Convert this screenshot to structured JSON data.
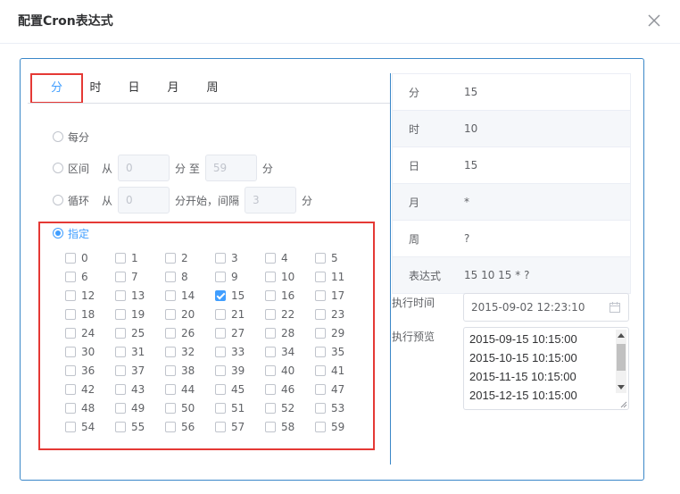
{
  "dialog": {
    "title": "配置Cron表达式"
  },
  "tabs": [
    "分",
    "时",
    "日",
    "月",
    "周"
  ],
  "options": {
    "every": "每分",
    "range": {
      "label": "区间",
      "from": "从",
      "start": "0",
      "unit_to": "分 至",
      "end": "59",
      "unit": "分"
    },
    "loop": {
      "label": "循环",
      "from": "从",
      "start": "0",
      "unit_start": "分开始，间隔",
      "interval": "3",
      "unit": "分"
    },
    "specify": "指定"
  },
  "minutes": [
    "0",
    "1",
    "2",
    "3",
    "4",
    "5",
    "6",
    "7",
    "8",
    "9",
    "10",
    "11",
    "12",
    "13",
    "14",
    "15",
    "16",
    "17",
    "18",
    "19",
    "20",
    "21",
    "22",
    "23",
    "24",
    "25",
    "26",
    "27",
    "28",
    "29",
    "30",
    "31",
    "32",
    "33",
    "34",
    "35",
    "36",
    "37",
    "38",
    "39",
    "40",
    "41",
    "42",
    "43",
    "44",
    "45",
    "46",
    "47",
    "48",
    "49",
    "50",
    "51",
    "52",
    "53",
    "54",
    "55",
    "56",
    "57",
    "58",
    "59"
  ],
  "checked_minutes": [
    "15"
  ],
  "summary": [
    {
      "key": "分",
      "value": "15"
    },
    {
      "key": "时",
      "value": "10"
    },
    {
      "key": "日",
      "value": "15"
    },
    {
      "key": "月",
      "value": "*"
    },
    {
      "key": "周",
      "value": "?"
    },
    {
      "key": "表达式",
      "value": "15 10 15 * ?"
    }
  ],
  "exec_time": {
    "label": "执行时间",
    "value": "2015-09-02 12:23:10"
  },
  "exec_preview": {
    "label": "执行预览",
    "lines": [
      "2015-09-15 10:15:00",
      "2015-10-15 10:15:00",
      "2015-11-15 10:15:00",
      "2015-12-15 10:15:00"
    ]
  },
  "colors": {
    "accent": "#409eff",
    "highlight_border": "#e53935",
    "panel_border": "#3a87c8"
  }
}
